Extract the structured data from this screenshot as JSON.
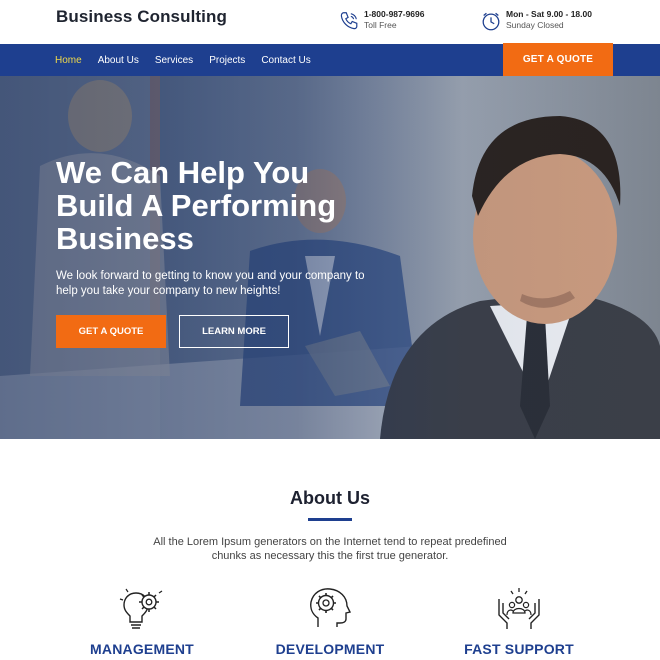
{
  "header": {
    "brand": "Business Consulting",
    "phone": {
      "number": "1-800-987-9696",
      "label": "Toll Free",
      "icon": "phone-icon"
    },
    "hours": {
      "text": "Mon - Sat 9.00 - 18.00",
      "label": "Sunday Closed",
      "icon": "clock-icon"
    }
  },
  "nav": {
    "items": [
      {
        "label": "Home",
        "active": true
      },
      {
        "label": "About Us"
      },
      {
        "label": "Services"
      },
      {
        "label": "Projects"
      },
      {
        "label": "Contact Us"
      }
    ],
    "cta": "GET A QUOTE"
  },
  "hero": {
    "title": "We Can Help You Build A Performing Business",
    "subtitle": "We look forward to getting to know you and your company to help you take your company to new heights!",
    "primary_button": "GET A QUOTE",
    "secondary_button": "LEARN MORE"
  },
  "about": {
    "title": "About Us",
    "text": "All the Lorem Ipsum generators on the Internet tend to repeat predefined chunks as necessary this the first true generator.",
    "features": [
      {
        "label": "MANAGEMENT",
        "icon": "gear-bulb-icon"
      },
      {
        "label": "DEVELOPMENT",
        "icon": "gear-head-icon"
      },
      {
        "label": "FAST SUPPORT",
        "icon": "hands-team-icon"
      }
    ]
  },
  "colors": {
    "nav_bg": "#1e3f8f",
    "accent": "#f26b13",
    "active_nav": "#f0d94a",
    "feature_label": "#1e3f8f"
  }
}
